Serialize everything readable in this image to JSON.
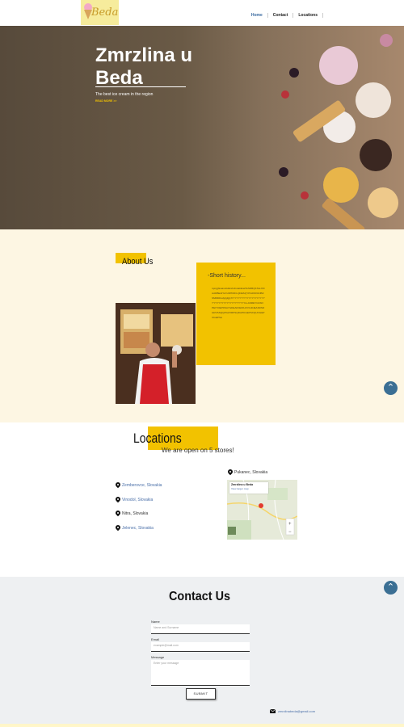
{
  "header": {
    "logo_text": "Beda",
    "nav": [
      "Home",
      "Contact",
      "Locations"
    ]
  },
  "hero": {
    "title_line1": "Zmrzlina u",
    "title_line2": "Beda",
    "subtitle": "The best ice cream  in the region",
    "link": "READ MORE >>"
  },
  "about": {
    "title": "About Us",
    "history_title": "-Short history...",
    "history_text": "rqxrgjbisaimdsikkxhvbslakkkaHASDBQKSGJXIIAADBEAHLXUDHIDFLQDESQYPGROKMJBZSMRDDsdyfgfgfyfYYYYYYYYYYYYYYYYYYYYYYYYYYYYYYYYYYYYYYYYLLASREYCASOPEIYOEPDSAYGDEAFIIEDIUAYIGDJEASDSDGRVSSQQPGZXRPSQDAPKGEPSXQUOGEPOGEPSA"
  },
  "locations": {
    "title": "Locations",
    "subtitle": "We are open on 5 stores!",
    "items": [
      "Zemberovce, Slovakia",
      "Vinodol, Slovakia",
      "Nitra, Slovakia",
      "Jelenec, Slovakia"
    ],
    "map_place": "Pukanec, Slovakia",
    "map_card_title": "Zmrzlina u Beda",
    "map_card_link": "View larger map"
  },
  "contact": {
    "title": "Contact Us",
    "name_label": "Name",
    "name_placeholder": "Name and Surname",
    "email_label": "Email",
    "email_placeholder": "example@mail.com",
    "message_label": "Message",
    "message_placeholder": "Enter your message",
    "submit_label": "SUBMIT",
    "email_address": "zmrzlinabeda@gmail.com"
  },
  "colors": {
    "accent_yellow": "#f2c200",
    "cream_bg": "#fdf6e3",
    "link_blue": "#4a6fa8",
    "scroll_button": "#3b6f94"
  }
}
